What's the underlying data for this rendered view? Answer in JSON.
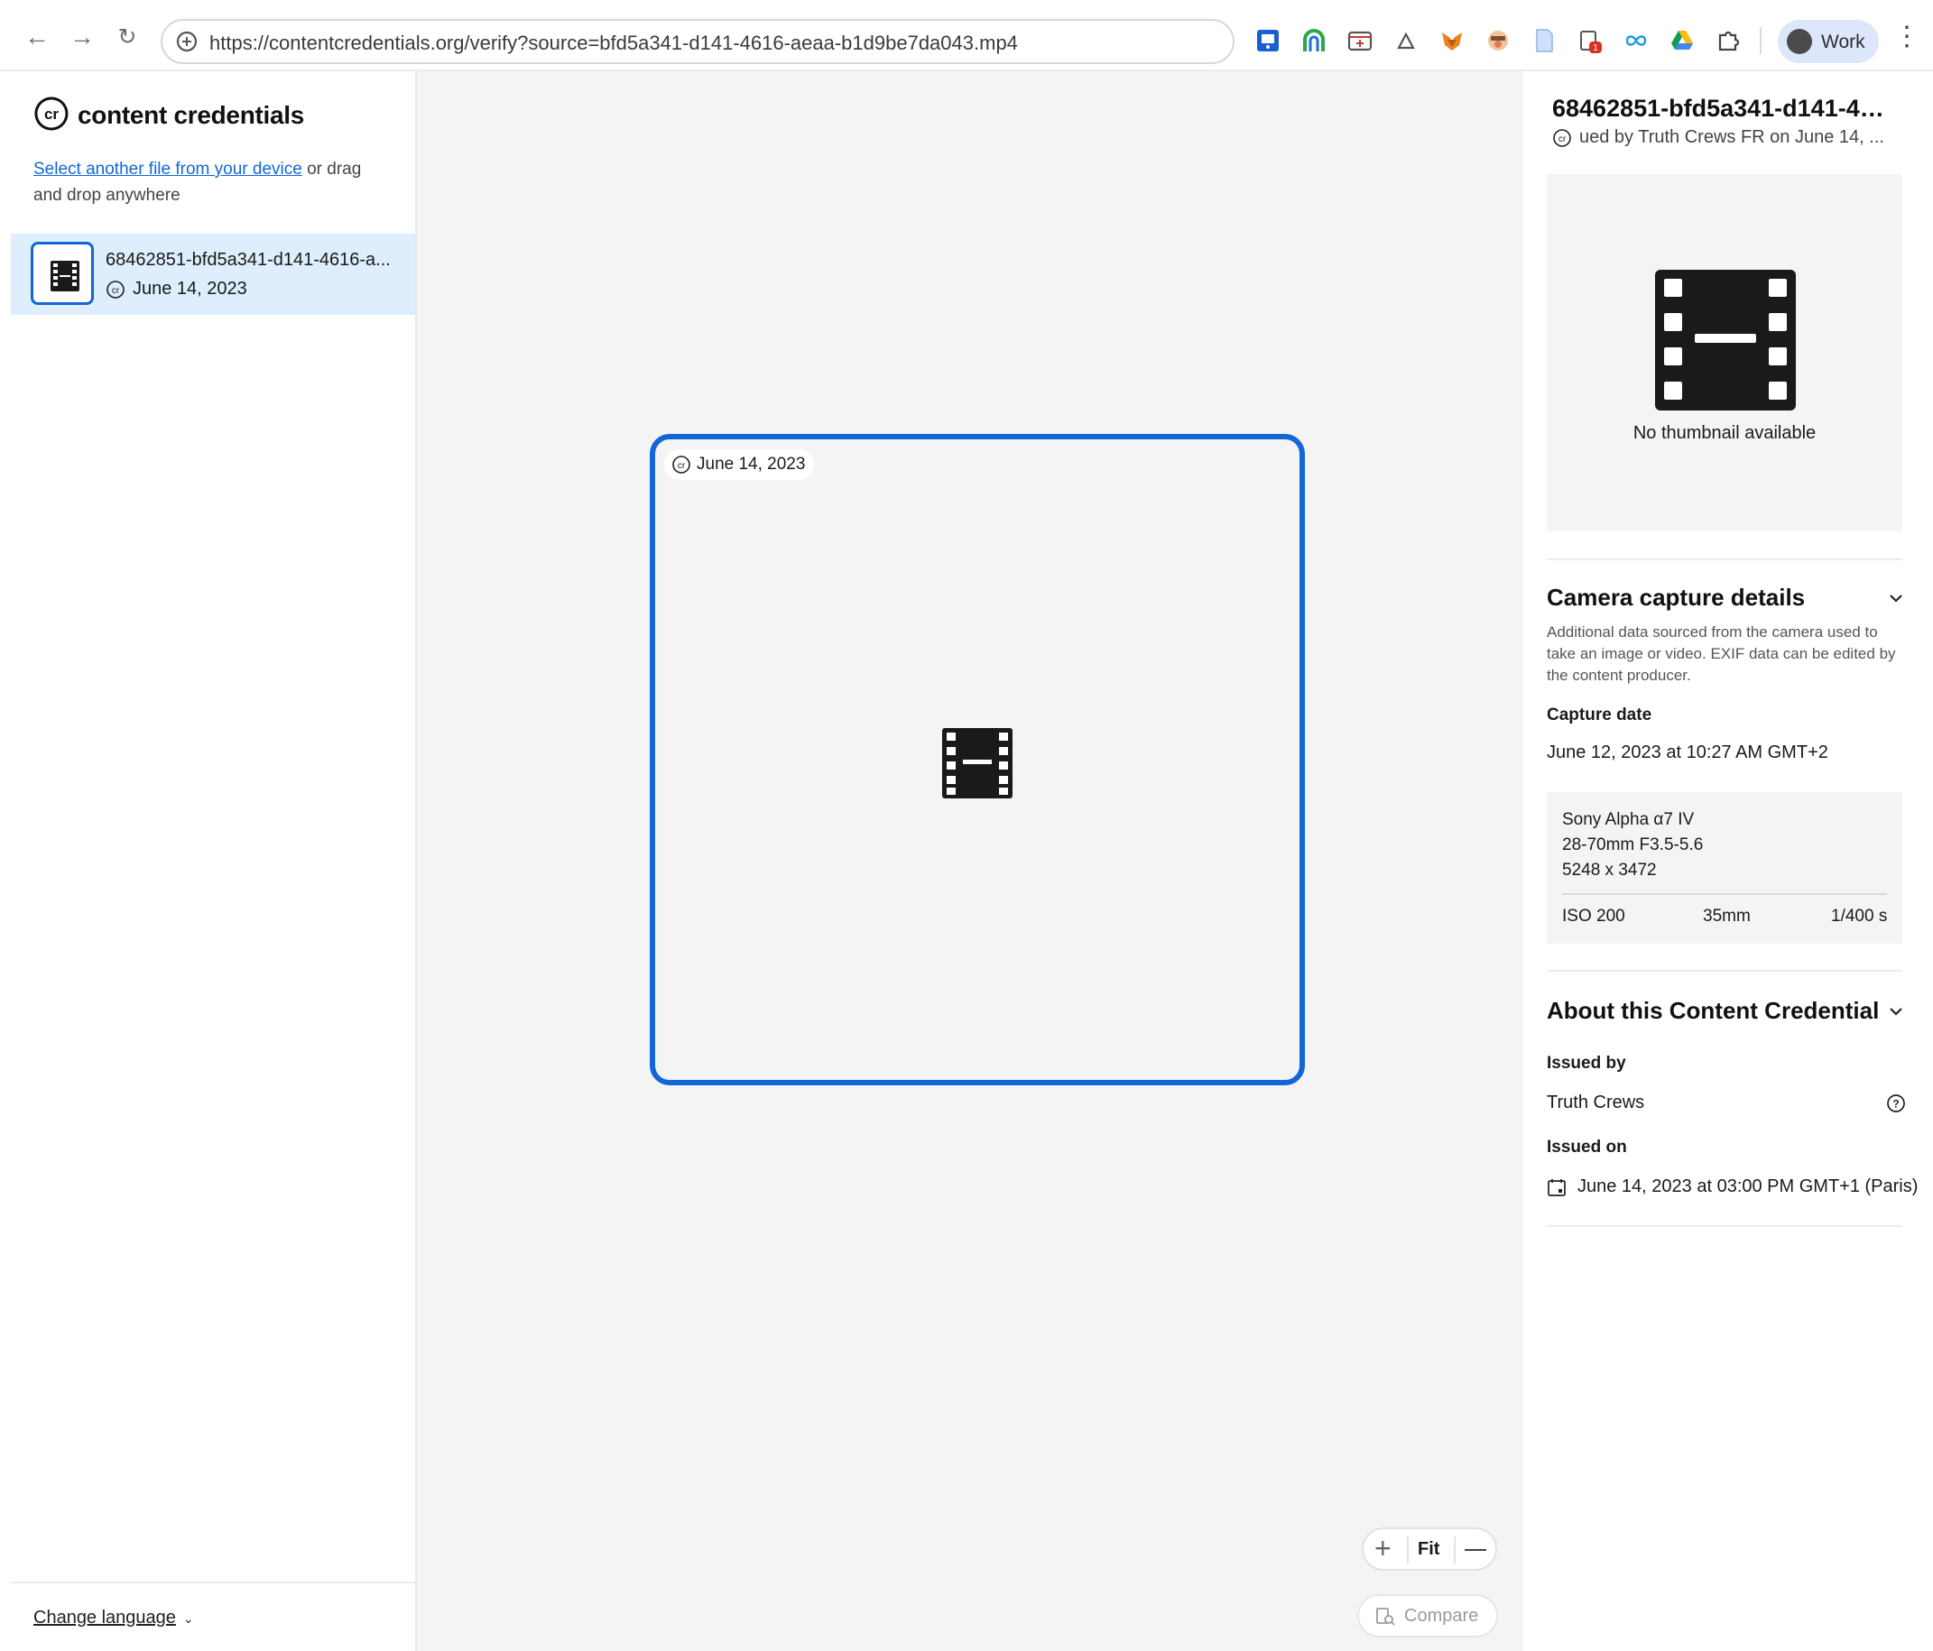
{
  "browser": {
    "url": "https://contentcredentials.org/verify?source=bfd5a341-d141-4616-aeaa-b1d9be7da043.mp4",
    "profile_label": "Work",
    "extension_badge": "1"
  },
  "sidebar": {
    "logo_text": "content credentials",
    "upload_link": "Select another file from your device",
    "upload_rest": " or drag and drop anywhere",
    "file": {
      "name": "68462851-bfd5a341-d141-4616-a...",
      "date": "June 14, 2023"
    },
    "language_label": "Change language"
  },
  "canvas": {
    "badge_date": "June 14, 2023",
    "zoom_fit": "Fit",
    "compare_label": "Compare"
  },
  "details": {
    "title": "68462851-bfd5a341-d141-4616...",
    "subtitle": "ued by Truth Crews FR on June 14, ...",
    "no_thumbnail": "No thumbnail available",
    "camera": {
      "section_title": "Camera capture details",
      "description": "Additional data sourced from the camera used to take an image or video. EXIF data can be edited by the content producer.",
      "capture_date_label": "Capture date",
      "capture_date": "June 12, 2023 at 10:27 AM GMT+2",
      "model": "Sony Alpha α7 IV",
      "lens": "28-70mm F3.5-5.6",
      "dimensions": "5248 x 3472",
      "iso": "ISO 200",
      "focal_length": "35mm",
      "shutter": "1/400 s"
    },
    "about": {
      "section_title": "About this Content Credential",
      "issued_by_label": "Issued by",
      "issued_by": "Truth Crews",
      "issued_on_label": "Issued on",
      "issued_on": "June 14, 2023 at 03:00 PM GMT+1 (Paris)"
    }
  },
  "colors": {
    "accent": "#1266d8",
    "selected_row": "#deeefc",
    "canvas_bg": "#f4f4f4"
  }
}
